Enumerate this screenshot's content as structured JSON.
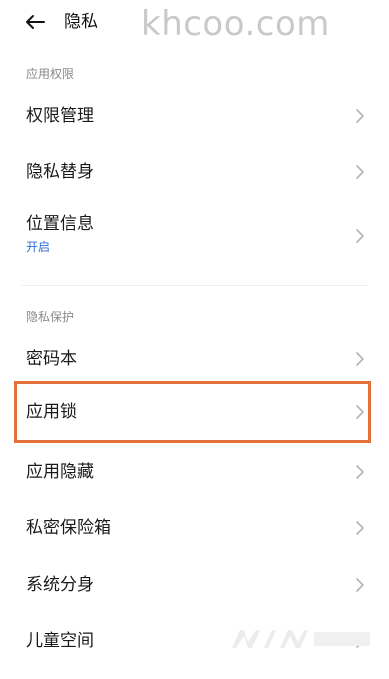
{
  "header": {
    "title": "隐私",
    "back_icon": "back-arrow-icon"
  },
  "watermark_top": "khcoo.com",
  "sections": [
    {
      "label": "应用权限",
      "items": [
        {
          "label": "权限管理"
        },
        {
          "label": "隐私替身"
        },
        {
          "label": "位置信息",
          "sub": "开启"
        }
      ]
    },
    {
      "label": "隐私保护",
      "items": [
        {
          "label": "密码本"
        },
        {
          "label": "应用锁"
        },
        {
          "label": "应用隐藏"
        },
        {
          "label": "私密保险箱"
        },
        {
          "label": "系统分身"
        },
        {
          "label": "儿童空间"
        }
      ]
    }
  ],
  "highlight_color": "#e4703a",
  "sub_color": "#2f6fd6"
}
